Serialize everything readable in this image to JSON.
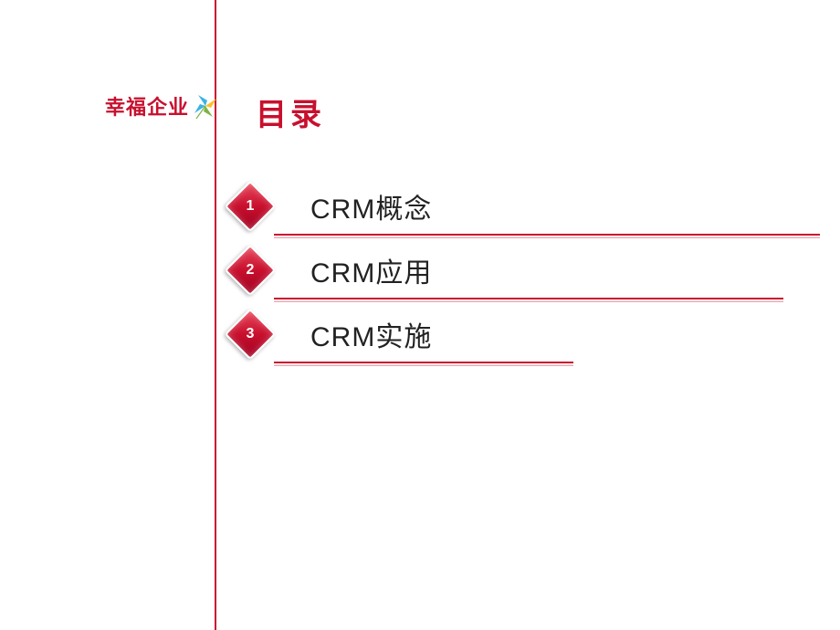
{
  "logo": {
    "text": "幸福企业",
    "icon_name": "pinwheel-icon",
    "colors": {
      "blue": "#3bb3e4",
      "yellow": "#fbc02d",
      "green": "#7cb342",
      "accent": "#c8102e"
    }
  },
  "title": "目录",
  "toc": [
    {
      "number": "1",
      "label": "CRM概念"
    },
    {
      "number": "2",
      "label": "CRM应用"
    },
    {
      "number": "3",
      "label": "CRM实施"
    }
  ],
  "brand_color": "#c8102e"
}
